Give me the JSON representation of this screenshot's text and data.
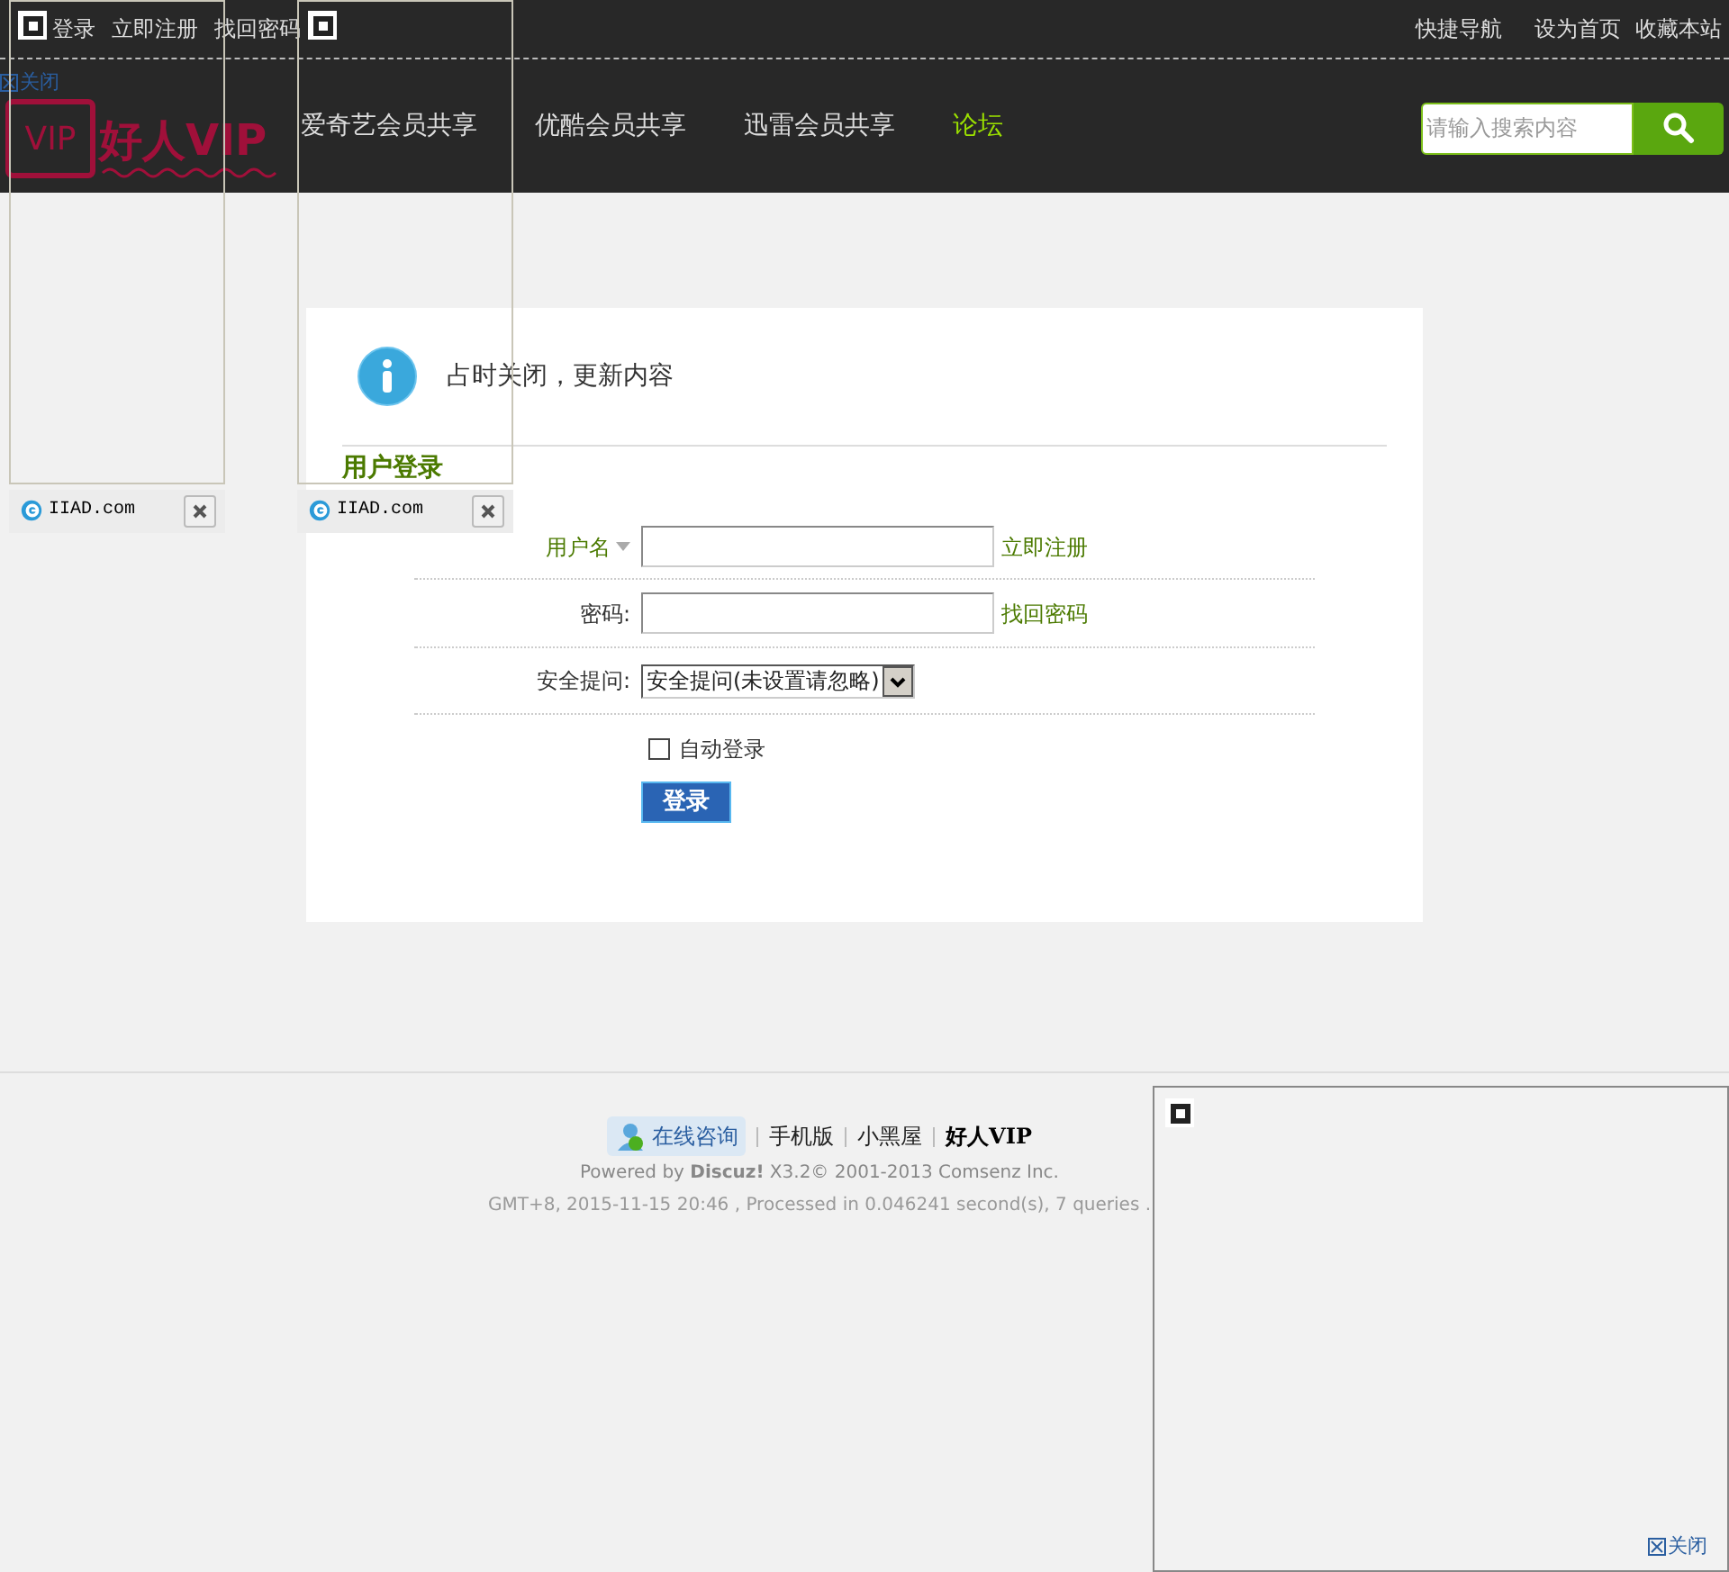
{
  "top_bar": {
    "left_links": [
      "登录",
      "立即注册",
      "找回密码"
    ],
    "right_links": [
      "快捷导航",
      "设为首页",
      "收藏本站"
    ]
  },
  "ad_close_top": "关闭",
  "logo": {
    "text": "好人VIP",
    "badge": "VIP"
  },
  "nav": [
    {
      "label": "爱奇艺会员共享",
      "selected": false
    },
    {
      "label": "优酷会员共享",
      "selected": false
    },
    {
      "label": "迅雷会员共享",
      "selected": false
    },
    {
      "label": "论坛",
      "selected": true
    }
  ],
  "search": {
    "placeholder": "请输入搜索内容"
  },
  "notice": "占时关闭，更新内容",
  "login": {
    "title": "用户登录",
    "username_label": "用户名",
    "register_link": "立即注册",
    "password_label": "密码:",
    "recover_link": "找回密码",
    "question_label": "安全提问:",
    "question_value": "安全提问(未设置请忽略)",
    "remember": {
      "label": "自动登录",
      "checked": false
    },
    "submit": "登录"
  },
  "ads": [
    {
      "label": "IIAD.com"
    },
    {
      "label": "IIAD.com"
    }
  ],
  "footer": {
    "chat": "在线咨询",
    "links": [
      "手机版",
      "小黑屋"
    ],
    "site": "好人VIP",
    "powered": "Powered by **Discuz!** X3.2© 2001-2013 Comsenz Inc.",
    "stats": "GMT+8, 2015-11-15 20:46 , Processed in 0.046241 second(s), 7 queries ."
  },
  "ad_close_bottom": "关闭"
}
